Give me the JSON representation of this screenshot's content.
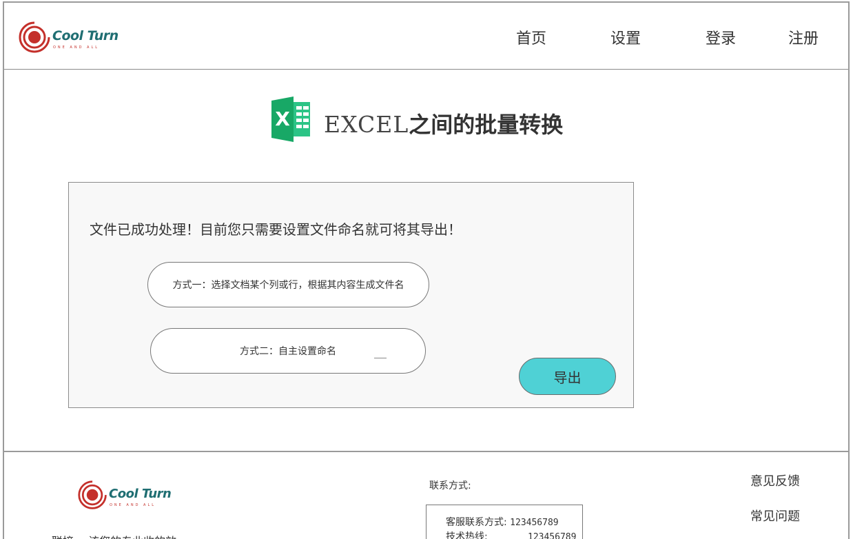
{
  "brand": {
    "name": "Cool Turn",
    "tagline": "ONE AND ALL",
    "colors": {
      "primary": "#1f6e72",
      "accent": "#c4302b"
    }
  },
  "nav": {
    "home": "首页",
    "settings": "设置",
    "login": "登录",
    "register": "注册"
  },
  "page": {
    "title_latin": "EXCEL",
    "title_zh": "之间的批量转换",
    "icon": "excel-icon"
  },
  "panel": {
    "message": "文件已成功处理！目前您只需要设置文件命名就可将其导出！",
    "option1": "方式一：选择文档某个列或行，根据其内容生成文件名",
    "option2": "方式二：自主设置命名",
    "export_label": "导出",
    "export_color": "#4fd1d5"
  },
  "footer": {
    "brand_name": "Cool Turn",
    "brand_tagline": "ONE AND ALL",
    "contact_label": "联系方式:",
    "contact_rows": [
      {
        "label": "客服联系方式:",
        "value": "123456789"
      },
      {
        "label": "技术热线:",
        "value": "123456789"
      }
    ],
    "feedback": "意见反馈",
    "faq": "常见问题",
    "clipped_text": "联接一 该您的专业收的效"
  }
}
